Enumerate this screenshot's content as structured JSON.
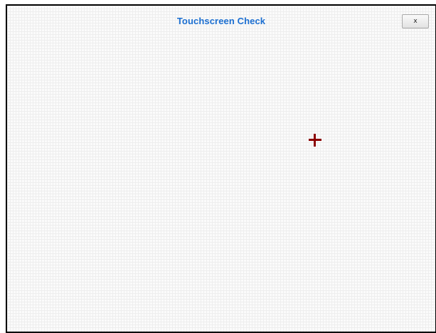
{
  "window": {
    "title": "Touchscreen Check",
    "close_label": "x"
  },
  "target": {
    "icon": "crosshair-plus-icon",
    "color": "#8b0000"
  },
  "colors": {
    "title": "#1c6fd1",
    "border": "#000000",
    "grid": "#eeeeee"
  }
}
